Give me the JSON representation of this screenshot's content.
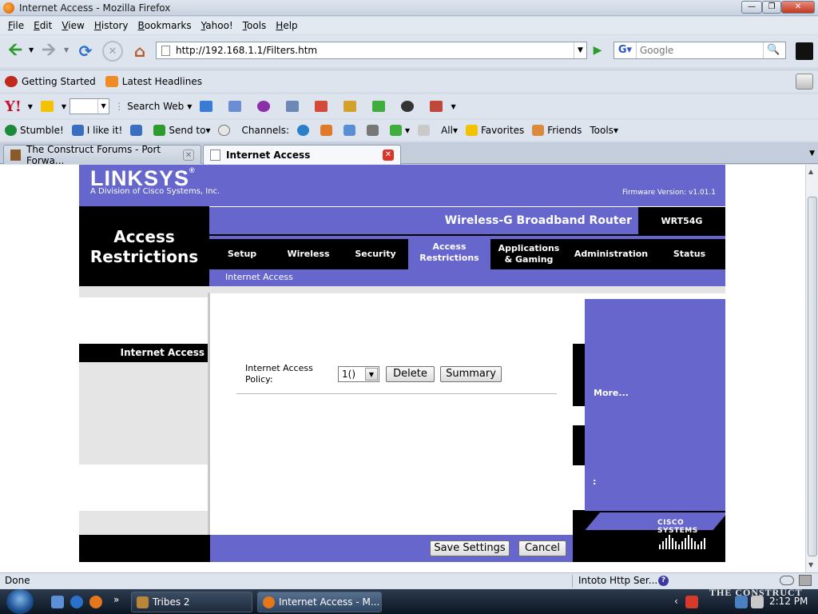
{
  "window": {
    "title": "Internet Access - Mozilla Firefox"
  },
  "menu": [
    {
      "label": "File",
      "u": "F",
      "rest": "ile"
    },
    {
      "label": "Edit",
      "u": "E",
      "rest": "dit"
    },
    {
      "label": "View",
      "u": "V",
      "rest": "iew"
    },
    {
      "label": "History",
      "u": "H",
      "rest": "istory"
    },
    {
      "label": "Bookmarks",
      "u": "B",
      "rest": "ookmarks"
    },
    {
      "label": "Yahoo!",
      "u": "Y",
      "rest": "ahoo!"
    },
    {
      "label": "Tools",
      "u": "T",
      "rest": "ools"
    },
    {
      "label": "Help",
      "u": "H",
      "rest": "elp"
    }
  ],
  "nav": {
    "url": "http://192.168.1.1/Filters.htm",
    "search_placeholder": "Google"
  },
  "bookmarks": [
    "Getting Started",
    "Latest Headlines"
  ],
  "yahoo_toolbar": {
    "search_label": "Search Web"
  },
  "stumble_toolbar": {
    "stumble": "Stumble!",
    "like": "I like it!",
    "send_to": "Send to",
    "channels": "Channels:",
    "all": "All",
    "favorites": "Favorites",
    "friends": "Friends",
    "tools": "Tools"
  },
  "tabs": [
    {
      "title": "The Construct Forums - Port Forwa...",
      "active": false
    },
    {
      "title": "Internet Access",
      "active": true
    }
  ],
  "router": {
    "logo": "LINKSYS",
    "division": "A Division of Cisco Systems, Inc.",
    "firmware": "Firmware Version: v1.01.1",
    "section_line1": "Access",
    "section_line2": "Restrictions",
    "product": "Wireless-G Broadband Router",
    "model": "WRT54G",
    "nav_setup": "Setup",
    "nav_wireless": "Wireless",
    "nav_security": "Security",
    "nav_access_1": "Access",
    "nav_access_2": "Restrictions",
    "nav_apps_1": "Applications",
    "nav_apps_2": "& Gaming",
    "nav_admin": "Administration",
    "nav_status": "Status",
    "sub_nav": "Internet Access",
    "left_label": "Internet Access",
    "policy_label_1": "Internet Access",
    "policy_label_2": "Policy:",
    "policy_selected": "1()",
    "delete_label": "Delete",
    "summary_label": "Summary",
    "more_label": "More...",
    "colon_label": ":",
    "cisco_label": "CISCO SYSTEMS",
    "save_label": "Save Settings",
    "cancel_label": "Cancel"
  },
  "status": {
    "text": "Done",
    "proxy": "Intoto Http Ser..."
  },
  "taskbar": {
    "items": [
      {
        "label": "Tribes 2",
        "active": false
      },
      {
        "label": "Internet Access - M...",
        "active": true
      }
    ],
    "watermark": "THE CONSTRUCT",
    "clock": "2:12 PM"
  }
}
